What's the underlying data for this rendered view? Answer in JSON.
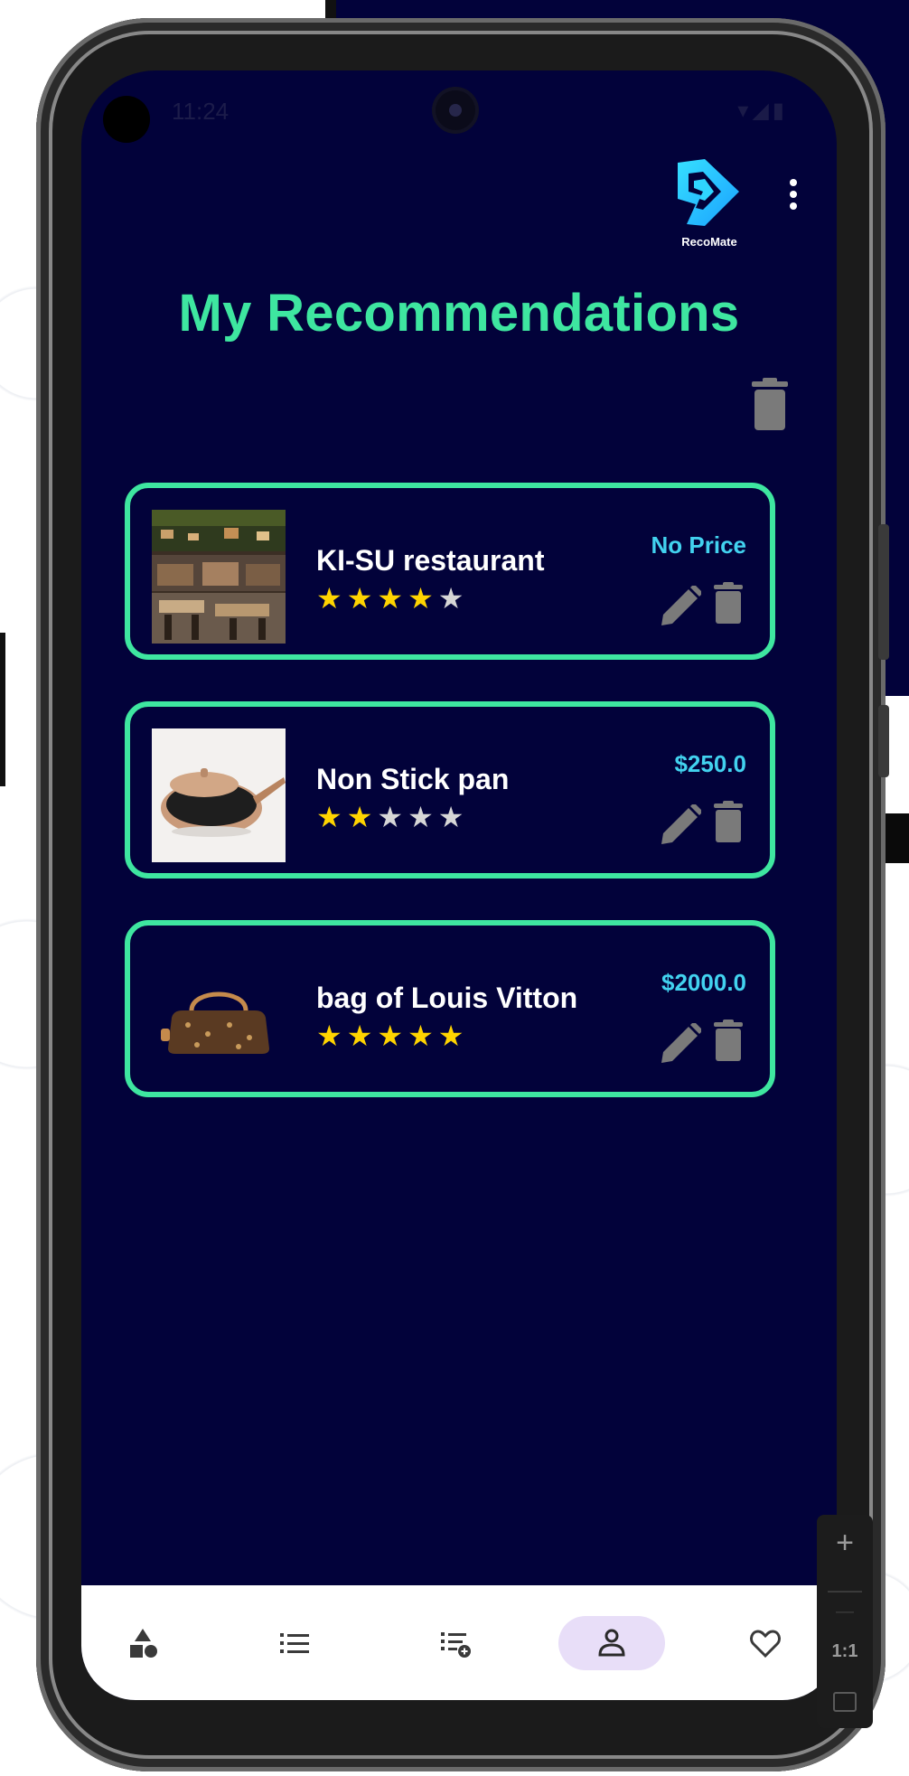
{
  "status_bar": {
    "time": "11:24",
    "icons": "▾◢▮"
  },
  "app": {
    "logo_text": "RecoMate",
    "page_title": "My Recommendations"
  },
  "recommendations": [
    {
      "name": "KI-SU restaurant",
      "price": "No Price",
      "rating": 4,
      "max_rating": 5,
      "image": "restaurant-photo"
    },
    {
      "name": "Non Stick pan",
      "price": "$250.0",
      "rating": 2,
      "max_rating": 5,
      "image": "pan-photo"
    },
    {
      "name": "bag of Louis Vitton",
      "price": "$2000.0",
      "rating": 5,
      "max_rating": 5,
      "image": "handbag-photo"
    }
  ],
  "bottom_nav": [
    {
      "icon": "categories-icon",
      "active": false
    },
    {
      "icon": "list-icon",
      "active": false
    },
    {
      "icon": "add-list-icon",
      "active": false
    },
    {
      "icon": "person-icon",
      "active": true
    },
    {
      "icon": "heart-icon",
      "active": false
    }
  ],
  "emulator_controls": {
    "zoom_in": "+",
    "zoom_out": "—",
    "actual_size": "1:1"
  },
  "colors": {
    "background": "#02023a",
    "accent": "#3ee6a0",
    "price": "#42d2ef",
    "star_on": "#ffd400",
    "star_off": "#d6d6d6",
    "icon_gray": "#7a7a7a",
    "nav_active": "#e8def8"
  }
}
